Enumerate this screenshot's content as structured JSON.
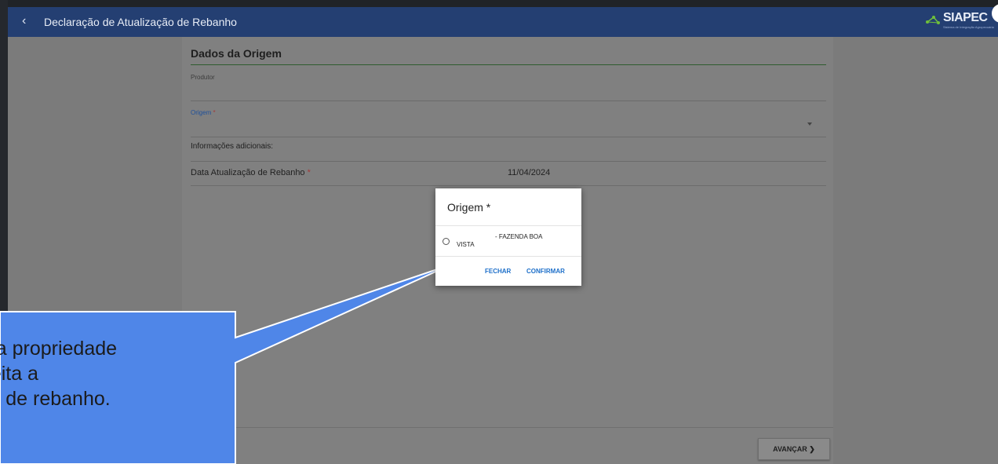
{
  "header": {
    "title": "Declaração de Atualização de Rebanho",
    "logo_text": "SIAPEC",
    "logo_subtitle": "Sistema de Integração Agropecuária"
  },
  "form": {
    "section_title": "Dados da Origem",
    "produtor_label": "Produtor",
    "origem_label": "Origem",
    "required_mark": "*",
    "info_label": "Informações adicionais:",
    "date_label": "Data Atualização de Rebanho",
    "date_value": "11/04/2024",
    "next_button": "AVANÇAR ❯"
  },
  "modal": {
    "title": "Origem *",
    "option_text_a": "- FAZENDA BOA",
    "option_text_b": "VISTA",
    "close_button": "FECHAR",
    "confirm_button": "CONFIRMAR"
  },
  "callout": {
    "line1": "ne a propriedade",
    "line2": "á feita a",
    "line3": "ção de rebanho."
  },
  "colors": {
    "header_bg": "#243f72",
    "accent_blue": "#1d6fc9",
    "callout_fill": "#4f86e8",
    "required_red": "#a23a3a"
  },
  "icons": [
    "chevron-left-icon",
    "siapec-logo-icon",
    "radio-unselected-icon",
    "dropdown-arrow-icon"
  ]
}
